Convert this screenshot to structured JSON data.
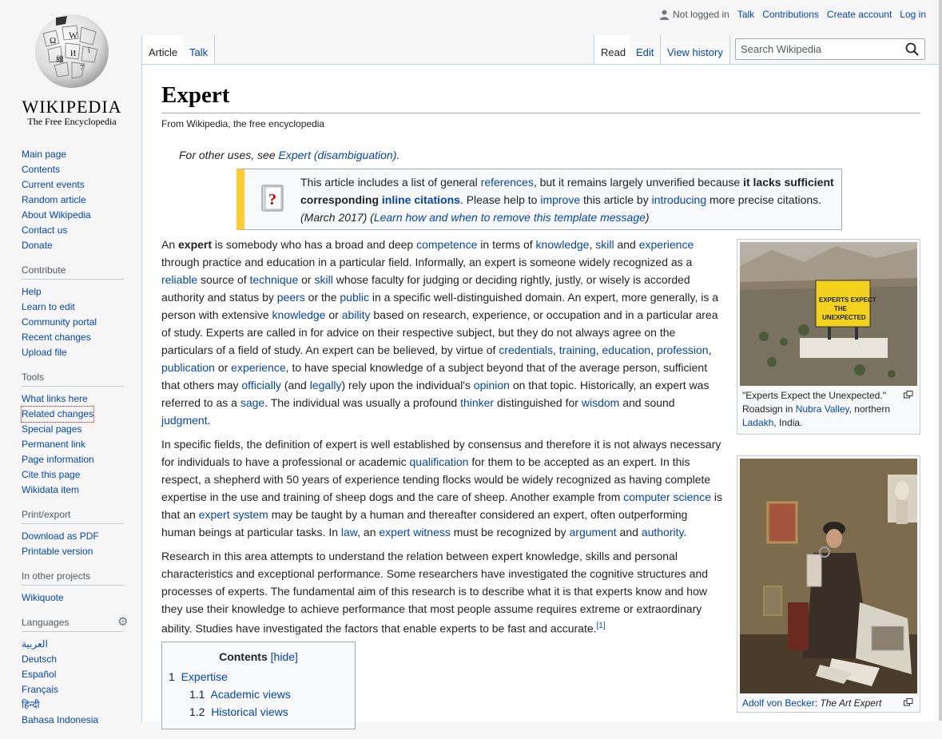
{
  "personal_tools": {
    "not_logged_in": "Not logged in",
    "talk": "Talk",
    "contributions": "Contributions",
    "create_account": "Create account",
    "log_in": "Log in"
  },
  "logo": {
    "wordmark": "WIKIPEDIA",
    "tagline": "The Free Encyclopedia"
  },
  "tabs": {
    "article": "Article",
    "talk": "Talk",
    "read": "Read",
    "edit": "Edit",
    "view_history": "View history"
  },
  "search": {
    "placeholder": "Search Wikipedia",
    "value": ""
  },
  "sidebar": {
    "navigation": [
      "Main page",
      "Contents",
      "Current events",
      "Random article",
      "About Wikipedia",
      "Contact us",
      "Donate"
    ],
    "contribute": {
      "heading": "Contribute",
      "items": [
        "Help",
        "Learn to edit",
        "Community portal",
        "Recent changes",
        "Upload file"
      ]
    },
    "tools": {
      "heading": "Tools",
      "items": [
        "What links here",
        "Related changes",
        "Special pages",
        "Permanent link",
        "Page information",
        "Cite this page",
        "Wikidata item"
      ]
    },
    "print": {
      "heading": "Print/export",
      "items": [
        "Download as PDF",
        "Printable version"
      ]
    },
    "projects": {
      "heading": "In other projects",
      "items": [
        "Wikiquote"
      ]
    },
    "languages": {
      "heading": "Languages",
      "items": [
        "العربية",
        "Deutsch",
        "Español",
        "Français",
        "हिन्दी",
        "Bahasa Indonesia"
      ]
    }
  },
  "article": {
    "title": "Expert",
    "site_sub": "From Wikipedia, the free encyclopedia",
    "hatnote": {
      "prefix": "For other uses, see ",
      "link": "Expert (disambiguation)",
      "suffix": "."
    },
    "ambox": {
      "t1": "This article includes a list of general ",
      "l1": "references",
      "t2": ", but it remains largely unverified because ",
      "b1": "it lacks sufficient corresponding ",
      "bl1": "inline citations",
      "t3": ". Please help to ",
      "l2": "improve",
      "t4": " this article by ",
      "l3": "introducing",
      "t5": " more precise citations.",
      "date": "(March 2017)",
      "learn": "Learn how and when to remove this template message"
    },
    "p1": [
      [
        "t",
        "An "
      ],
      [
        "b",
        "expert"
      ],
      [
        "t",
        " is somebody who has a broad and deep "
      ],
      [
        "l",
        "competence"
      ],
      [
        "t",
        " in terms of "
      ],
      [
        "l",
        "knowledge"
      ],
      [
        "t",
        ", "
      ],
      [
        "l",
        "skill"
      ],
      [
        "t",
        " and "
      ],
      [
        "l",
        "experience"
      ],
      [
        "t",
        " through practice and education in a particular field. Informally, an expert is someone widely recognized as a "
      ],
      [
        "l",
        "reliable"
      ],
      [
        "t",
        " source of "
      ],
      [
        "l",
        "technique"
      ],
      [
        "t",
        " or "
      ],
      [
        "l",
        "skill"
      ],
      [
        "t",
        " whose faculty for judging or deciding rightly, justly, or wisely is accorded authority and status by "
      ],
      [
        "l",
        "peers"
      ],
      [
        "t",
        " or the "
      ],
      [
        "l",
        "public"
      ],
      [
        "t",
        " in a specific well-distinguished domain. An expert, more generally, is a person with extensive "
      ],
      [
        "l",
        "knowledge"
      ],
      [
        "t",
        " or "
      ],
      [
        "l",
        "ability"
      ],
      [
        "t",
        " based on research, experience, or occupation and in a particular area of study. Experts are called in for advice on their respective subject, but they do not always agree on the particulars of a field of study. An expert can be believed, by virtue of "
      ],
      [
        "l",
        "credentials"
      ],
      [
        "t",
        ", "
      ],
      [
        "l",
        "training"
      ],
      [
        "t",
        ", "
      ],
      [
        "l",
        "education"
      ],
      [
        "t",
        ", "
      ],
      [
        "l",
        "profession"
      ],
      [
        "t",
        ", "
      ],
      [
        "l",
        "publication"
      ],
      [
        "t",
        " or "
      ],
      [
        "l",
        "experience"
      ],
      [
        "t",
        ", to have special knowledge of a subject beyond that of the average person, sufficient that others may "
      ],
      [
        "l",
        "officially"
      ],
      [
        "t",
        " (and "
      ],
      [
        "l",
        "legally"
      ],
      [
        "t",
        ") rely upon the individual's "
      ],
      [
        "l",
        "opinion"
      ],
      [
        "t",
        " on that topic. Historically, an expert was referred to as a "
      ],
      [
        "l",
        "sage"
      ],
      [
        "t",
        ". The individual was usually a profound "
      ],
      [
        "l",
        "thinker"
      ],
      [
        "t",
        " distinguished for "
      ],
      [
        "l",
        "wisdom"
      ],
      [
        "t",
        " and sound "
      ],
      [
        "l",
        "judgment"
      ],
      [
        "t",
        "."
      ]
    ],
    "p2": [
      [
        "t",
        "In specific fields, the definition of expert is well established by consensus and therefore it is not always necessary for individuals to have a professional or academic "
      ],
      [
        "l",
        "qualification"
      ],
      [
        "t",
        " for them to be accepted as an expert. In this respect, a shepherd with 50 years of experience tending flocks would be widely recognized as having complete expertise in the use and training of sheep dogs and the care of sheep. Another example from "
      ],
      [
        "l",
        "computer science"
      ],
      [
        "t",
        " is that an "
      ],
      [
        "l",
        "expert system"
      ],
      [
        "t",
        " may be taught by a human and thereafter considered an expert, often outperforming human beings at particular tasks. In "
      ],
      [
        "l",
        "law"
      ],
      [
        "t",
        ", an "
      ],
      [
        "l",
        "expert witness"
      ],
      [
        "t",
        " must be recognized by "
      ],
      [
        "l",
        "argument"
      ],
      [
        "t",
        " and "
      ],
      [
        "l",
        "authority"
      ],
      [
        "t",
        "."
      ]
    ],
    "p3": [
      [
        "t",
        "Research in this area attempts to understand the relation between expert knowledge, skills and personal characteristics and exceptional performance. Some researchers have investigated the cognitive structures and processes of experts. The fundamental aim of this research is to describe what it is that experts know and how they use their knowledge to achieve performance that most people assume requires extreme or extraordinary ability. Studies have investigated the factors that enable experts to be fast and accurate."
      ],
      [
        "sup",
        "[1]"
      ]
    ],
    "toc": {
      "title": "Contents",
      "hide": "[hide]",
      "entries": [
        {
          "num": "1",
          "label": "Expertise"
        },
        {
          "num": "1.1",
          "label": "Academic views"
        },
        {
          "num": "1.2",
          "label": "Historical views"
        }
      ]
    },
    "figure1": {
      "sign_text": "EXPERTS EXPECT THE UNEXPECTED",
      "caption_prefix": "\"Experts Expect the Unexpected.\" Roadsign in ",
      "caption_link1": "Nubra Valley",
      "caption_mid": ", northern ",
      "caption_link2": "Ladakh",
      "caption_suffix": ", India."
    },
    "figure2": {
      "caption_link": "Adolf von Becker",
      "caption_suffix": ": ",
      "caption_italic": "The Art Expert"
    }
  },
  "colors": {
    "link": "#0645ad",
    "ambox_stripe": "#ffcc33",
    "border": "#a7d7f9"
  }
}
